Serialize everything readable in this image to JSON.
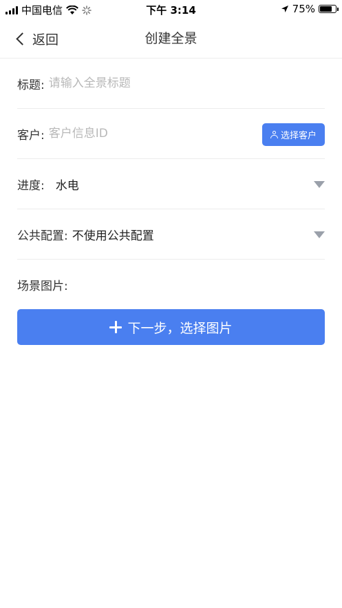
{
  "status_bar": {
    "carrier": "中国电信",
    "time": "下午 3:14",
    "battery": "75%",
    "battery_level": 0.75
  },
  "nav": {
    "back_label": "返回",
    "title": "创建全景"
  },
  "form": {
    "title_label": "标题:",
    "title_placeholder": "请输入全景标题",
    "customer_label": "客户:",
    "customer_placeholder": "客户信息ID",
    "select_customer_label": "选择客户",
    "progress_label": "进度:",
    "progress_value": "水电",
    "public_config_label": "公共配置:",
    "public_config_value": "不使用公共配置",
    "scene_images_label": "场景图片:"
  },
  "next_button_label": "下一步，选择图片",
  "icons": {
    "signal": "signal-icon",
    "wifi": "wifi-icon",
    "loading": "loading-icon",
    "location": "location-arrow-icon",
    "battery": "battery-icon",
    "back": "chevron-left-icon",
    "user": "user-icon",
    "dropdown": "caret-down-icon",
    "plus": "plus-icon"
  },
  "colors": {
    "primary": "#4a7ff0",
    "placeholder": "#b8b8b8",
    "caret": "#9aa0aa"
  }
}
